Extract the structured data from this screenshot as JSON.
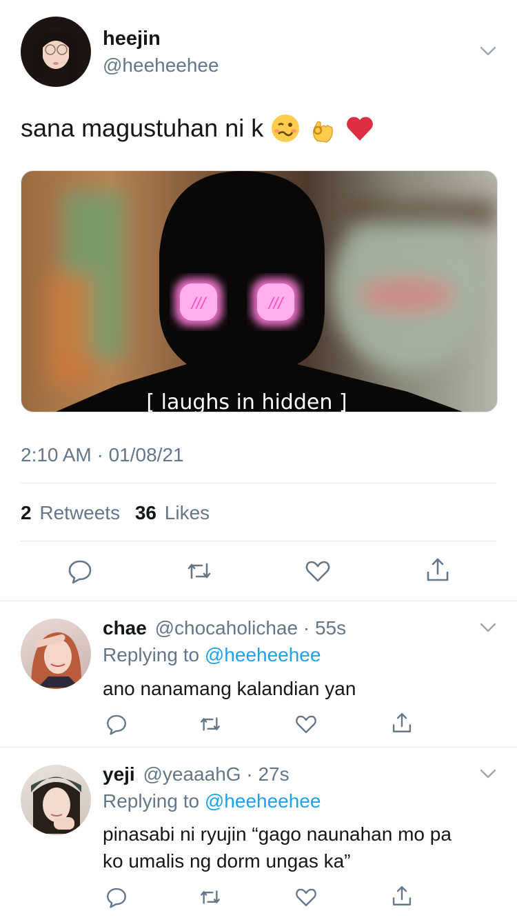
{
  "main_tweet": {
    "display_name": "heejin",
    "handle": "@heeheehee",
    "text": "sana magustuhan ni k 🥴👌❤️",
    "text_plain": "sana magustuhan ni k",
    "emojis": [
      "woozy-face",
      "ok-hand",
      "red-heart"
    ],
    "media_caption": "[ laughs in hidden ]",
    "media_eye_text": "///",
    "timestamp": "2:10 AM · 01/08/21",
    "retweets_count": "2",
    "retweets_label": "Retweets",
    "likes_count": "36",
    "likes_label": "Likes"
  },
  "replies": [
    {
      "display_name": "chae",
      "handle": "@chocaholichae",
      "time": "55s",
      "replying_label": "Replying to",
      "replying_to": "@heeheehee",
      "text": "ano nanamang kalandian yan"
    },
    {
      "display_name": "yeji",
      "handle": "@yeaaahG",
      "time": "27s",
      "replying_label": "Replying to",
      "replying_to": "@heeheehee",
      "text_line1": "pinasabi ni ryujin “gago naunahan mo pa",
      "text_line2": "ko umalis ng dorm ungas ka”"
    }
  ],
  "colors": {
    "text": "#14171a",
    "muted": "#657786",
    "link": "#1da1f2",
    "divider": "#e1e8ed",
    "icon": "#657786",
    "eye_glow": "#ff7ad9"
  }
}
